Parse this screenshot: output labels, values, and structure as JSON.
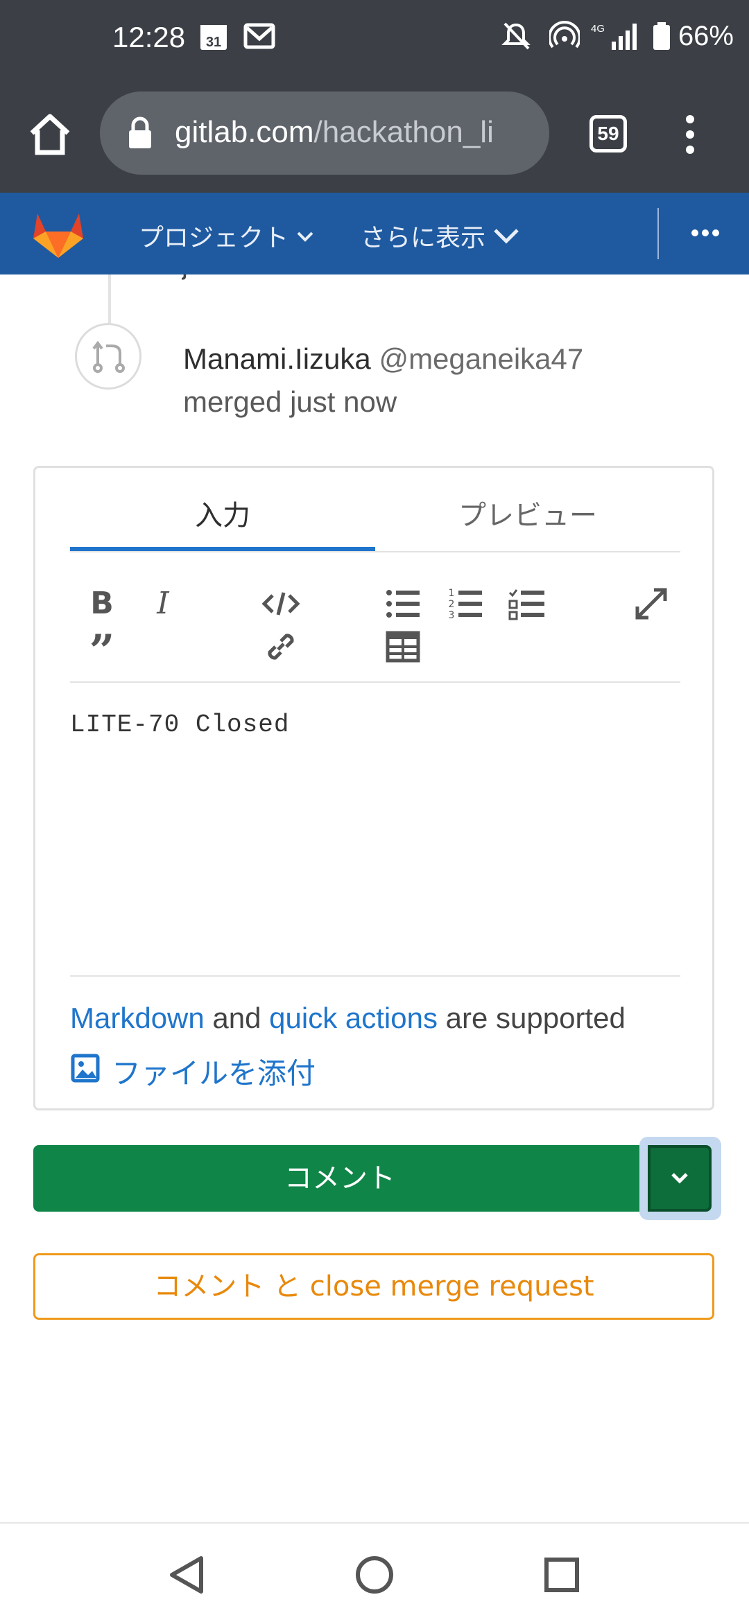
{
  "status_bar": {
    "time": "12:28",
    "calendar_day": "31",
    "network": "4G",
    "battery": "66%"
  },
  "browser": {
    "url_host": "gitlab.com",
    "url_path": "/hackathon_li",
    "tab_count": "59"
  },
  "gitlab_nav": {
    "projects_label": "プロジェクト",
    "more_label": "さらに表示"
  },
  "timeline": {
    "partial_text": "just now",
    "author_name": "Manami.Iizuka",
    "author_handle": "@meganeika47",
    "action": "merged just now"
  },
  "comment_box": {
    "tab_write": "入力",
    "tab_preview": "プレビュー",
    "editor_value": "LITE-70 Closed",
    "help_markdown": "Markdown",
    "help_and": " and ",
    "help_quick_actions": "quick actions",
    "help_supported": " are supported",
    "attach_label": "ファイルを添付"
  },
  "buttons": {
    "comment_label": "コメント",
    "close_label": "コメント と close merge request"
  },
  "colors": {
    "nav_blue": "#1f5aa0",
    "link_blue": "#1f75cb",
    "comment_green": "#108548",
    "close_orange": "#ef9a1a"
  }
}
